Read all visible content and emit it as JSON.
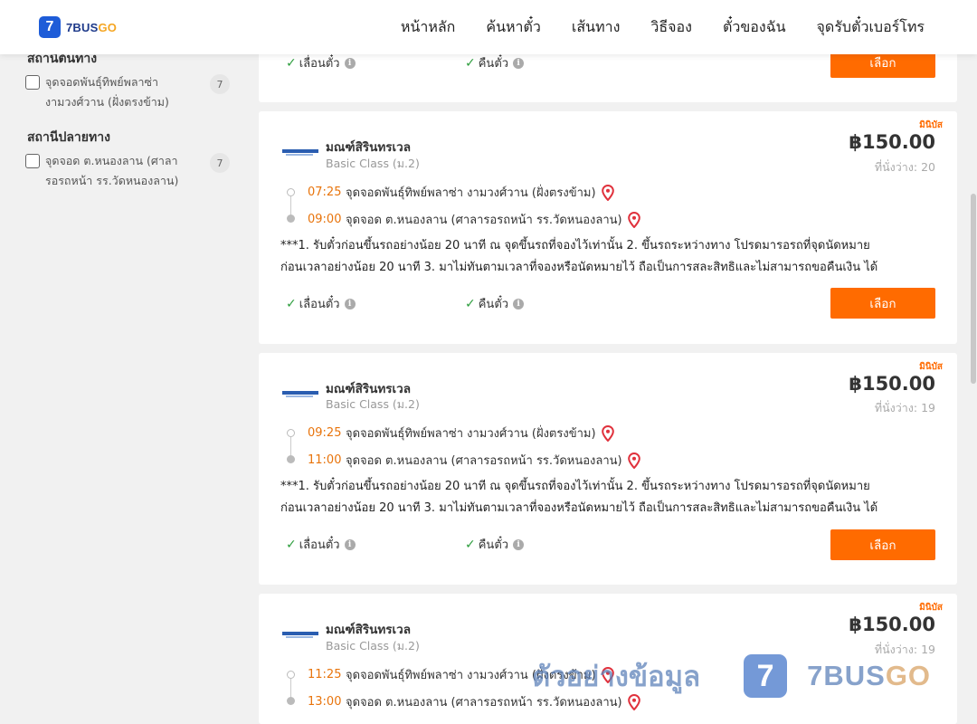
{
  "header": {
    "logo_number": "7",
    "logo_text_main": "7BUS",
    "logo_text_accent": "GO",
    "nav": [
      "หน้าหลัก",
      "ค้นหาตั๋ว",
      "เส้นทาง",
      "วิธีจอง",
      "ตั๋วของฉัน",
      "จุดรับตั๋วเบอร์โทร"
    ]
  },
  "sidebar": {
    "origin_title": "สถานีต้นทาง",
    "origin_options": [
      {
        "label": "จุดจอดพันธุ์ทิพย์พลาซ่า งามวงศ์วาน (ฝั่งตรงข้าม)",
        "count": "7",
        "checked": false
      }
    ],
    "destination_title": "สถานีปลายทาง",
    "destination_options": [
      {
        "label": "จุดจอด ต.หนองลาน (ศาลารอรถหน้า รร.วัดหนองลาน)",
        "count": "7",
        "checked": false
      }
    ]
  },
  "partial_card": {
    "feature_change": "เลื่อนตั๋ว",
    "feature_refund": "คืนตั๋ว",
    "select_label": "เลือก"
  },
  "cards": [
    {
      "tag": "มินิบัส",
      "operator": "มณฑ์สิรินทรเวล",
      "bus_class": "Basic Class (ม.2)",
      "price": "฿150.00",
      "seats": "ที่นั่งว่าง: 20",
      "depart_time": "07:25",
      "depart_stop": "จุดจอดพันธุ์ทิพย์พลาซ่า งามวงศ์วาน (ฝั่งตรงข้าม)",
      "arrive_time": "09:00",
      "arrive_stop": "จุดจอด ต.หนองลาน (ศาลารอรถหน้า รร.วัดหนองลาน)",
      "note_line1": "***1. รับตั๋วก่อนขึ้นรถอย่างน้อย 20 นาที ณ จุดขึ้นรถที่จองไว้เท่านั้น 2. ขึ้นรถระหว่างทาง โปรดมารอรถที่จุดนัดหมาย",
      "note_line2": "ก่อนเวลาอย่างน้อย 20 นาที 3. มาไม่ทันตามเวลาที่จองหรือนัดหมายไว้ ถือเป็นการสละสิทธิและไม่สามารถขอคืนเงิน ได้",
      "feature_change": "เลื่อนตั๋ว",
      "feature_refund": "คืนตั๋ว",
      "select_label": "เลือก"
    },
    {
      "tag": "มินิบัส",
      "operator": "มณฑ์สิรินทรเวล",
      "bus_class": "Basic Class (ม.2)",
      "price": "฿150.00",
      "seats": "ที่นั่งว่าง: 19",
      "depart_time": "09:25",
      "depart_stop": "จุดจอดพันธุ์ทิพย์พลาซ่า งามวงศ์วาน (ฝั่งตรงข้าม)",
      "arrive_time": "11:00",
      "arrive_stop": "จุดจอด ต.หนองลาน (ศาลารอรถหน้า รร.วัดหนองลาน)",
      "note_line1": "***1. รับตั๋วก่อนขึ้นรถอย่างน้อย 20 นาที ณ จุดขึ้นรถที่จองไว้เท่านั้น 2. ขึ้นรถระหว่างทาง โปรดมารอรถที่จุดนัดหมาย",
      "note_line2": "ก่อนเวลาอย่างน้อย 20 นาที 3. มาไม่ทันตามเวลาที่จองหรือนัดหมายไว้ ถือเป็นการสละสิทธิและไม่สามารถขอคืนเงิน ได้",
      "feature_change": "เลื่อนตั๋ว",
      "feature_refund": "คืนตั๋ว",
      "select_label": "เลือก"
    },
    {
      "tag": "มินิบัส",
      "operator": "มณฑ์สิรินทรเวล",
      "bus_class": "Basic Class (ม.2)",
      "price": "฿150.00",
      "seats": "ที่นั่งว่าง: 19",
      "depart_time": "11:25",
      "depart_stop": "จุดจอดพันธุ์ทิพย์พลาซ่า งามวงศ์วาน (ฝั่งตรงข้าม)",
      "arrive_time": "13:00",
      "arrive_stop": "จุดจอด ต.หนองลาน (ศาลารอรถหน้า รร.วัดหนองลาน)"
    }
  ],
  "watermark": {
    "text": "ตัวอย่างข้อมูล",
    "logo_number": "7",
    "brand_main": "7BUS",
    "brand_accent": "GO"
  },
  "colors": {
    "accent": "#ff6b00",
    "time": "#e8740c",
    "check": "#2e9e3e",
    "pin": "#e0313c",
    "brand_blue": "#1e5cd8"
  }
}
